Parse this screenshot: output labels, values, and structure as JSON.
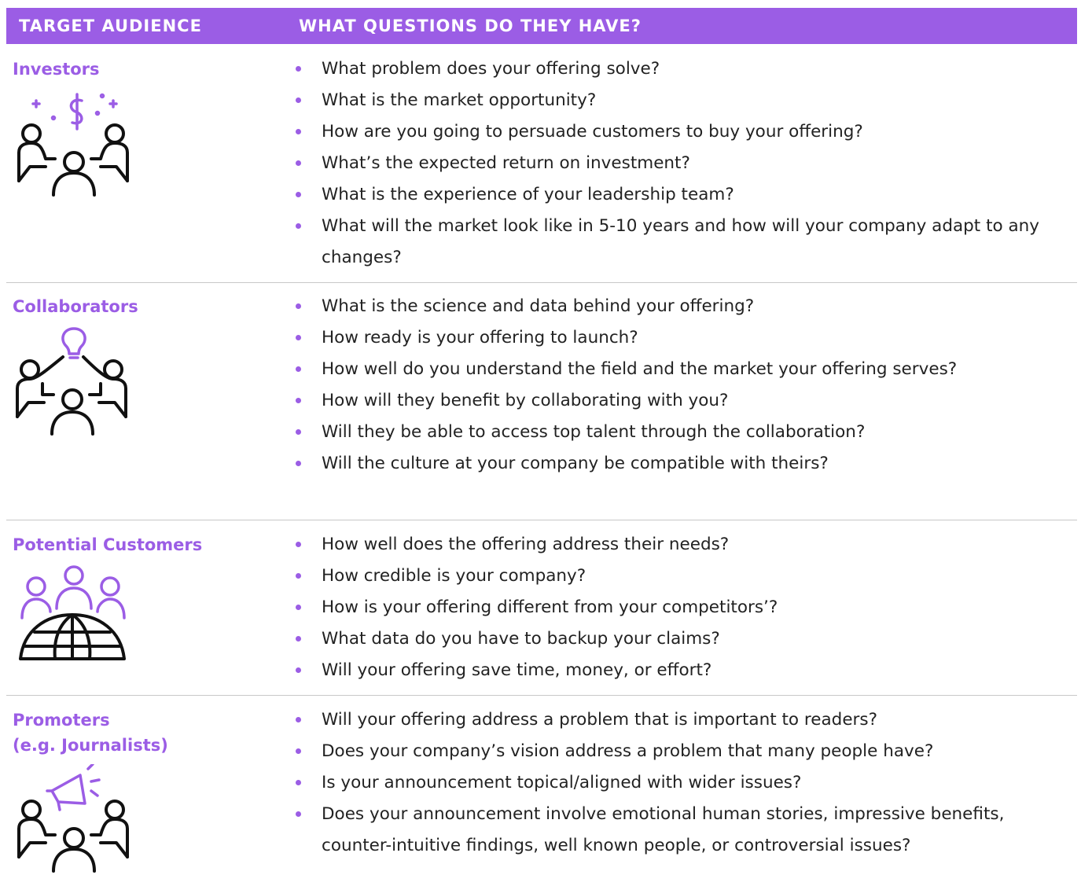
{
  "header": {
    "col1": "TARGET AUDIENCE",
    "col2": "WHAT QUESTIONS DO THEY HAVE?"
  },
  "colors": {
    "accent": "#9b5de5",
    "text": "#222222",
    "divider": "#c8c8c8"
  },
  "rows": [
    {
      "audience": "Investors",
      "icon": "investors-meeting-dollar-icon",
      "questions": [
        "What problem does your offering solve?",
        "What is the market opportunity?",
        "How are you going to persuade customers to buy your offering?",
        "What’s the expected return on investment?",
        "What is the experience of your leadership team?",
        "What will the market look like in 5-10 years and how will your company adapt to any changes?"
      ]
    },
    {
      "audience": "Collaborators",
      "icon": "collaborators-lightbulb-icon",
      "questions": [
        "What is the science and data behind your offering?",
        "How ready is your offering to launch?",
        "How well do you understand the field and the market your offering serves?",
        "How will they benefit by collaborating with you?",
        "Will they be able to access top talent through the collaboration?",
        "Will the culture at your company be compatible with theirs?"
      ]
    },
    {
      "audience": "Potential Customers",
      "icon": "customers-globe-icon",
      "questions": [
        "How well does the offering address their needs?",
        "How credible is your company?",
        "How is your offering different from your competitors’?",
        "What data do you have to backup your claims?",
        "Will your offering save time, money, or effort?"
      ]
    },
    {
      "audience": "Promoters\n(e.g. Journalists)",
      "audience_line1": "Promoters",
      "audience_line2": "(e.g. Journalists)",
      "icon": "promoters-megaphone-icon",
      "questions": [
        "Will your offering address a problem that is important to readers?",
        "Does your company’s vision address a problem that many people have?",
        "Is your announcement topical/aligned with wider issues?",
        "Does your announcement involve emotional human stories, impressive benefits, counter-intuitive findings, well known people, or controversial issues?"
      ]
    }
  ]
}
